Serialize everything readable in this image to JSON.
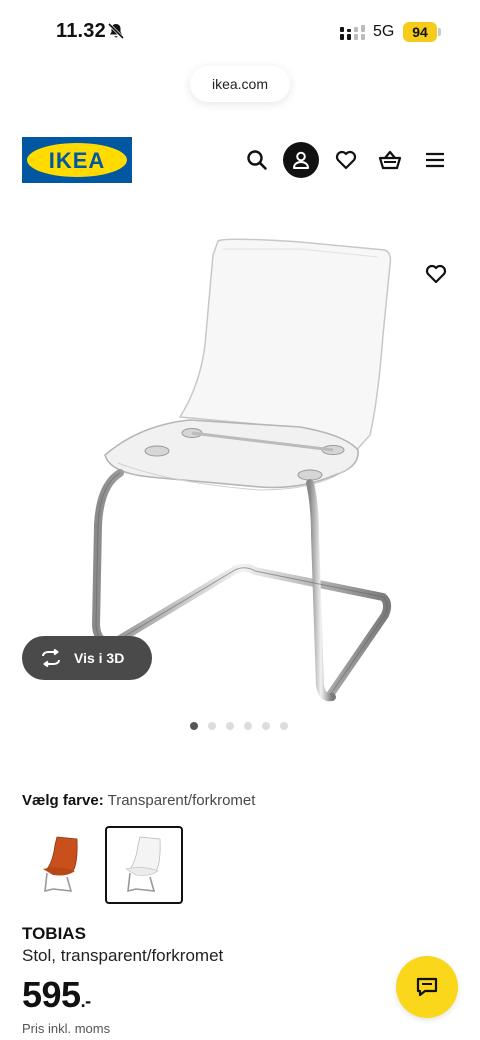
{
  "status_bar": {
    "time": "11.32",
    "network": "5G",
    "battery": "94"
  },
  "browser": {
    "url": "ikea.com"
  },
  "header": {
    "logo_text": "IKEA",
    "icons": [
      "search-icon",
      "account-icon",
      "heart-icon",
      "basket-icon",
      "menu-icon"
    ]
  },
  "gallery": {
    "view_3d_label": "Vis i 3D",
    "slide_count": 6,
    "active_slide": 1
  },
  "color_choice": {
    "label": "Vælg farve:",
    "value": "Transparent/forkromet",
    "swatches": [
      "orange chair",
      "transparent chair"
    ],
    "selected_swatch": 2
  },
  "product": {
    "name": "TOBIAS",
    "description": "Stol, transparent/forkromet",
    "price": "595",
    "price_suffix": ".-",
    "price_note": "Pris inkl. moms"
  },
  "colors": {
    "brand_blue": "#0058a3",
    "brand_yellow": "#ffdb00",
    "chat_yellow": "#fad71a",
    "orange_chair": "#c8501c"
  }
}
